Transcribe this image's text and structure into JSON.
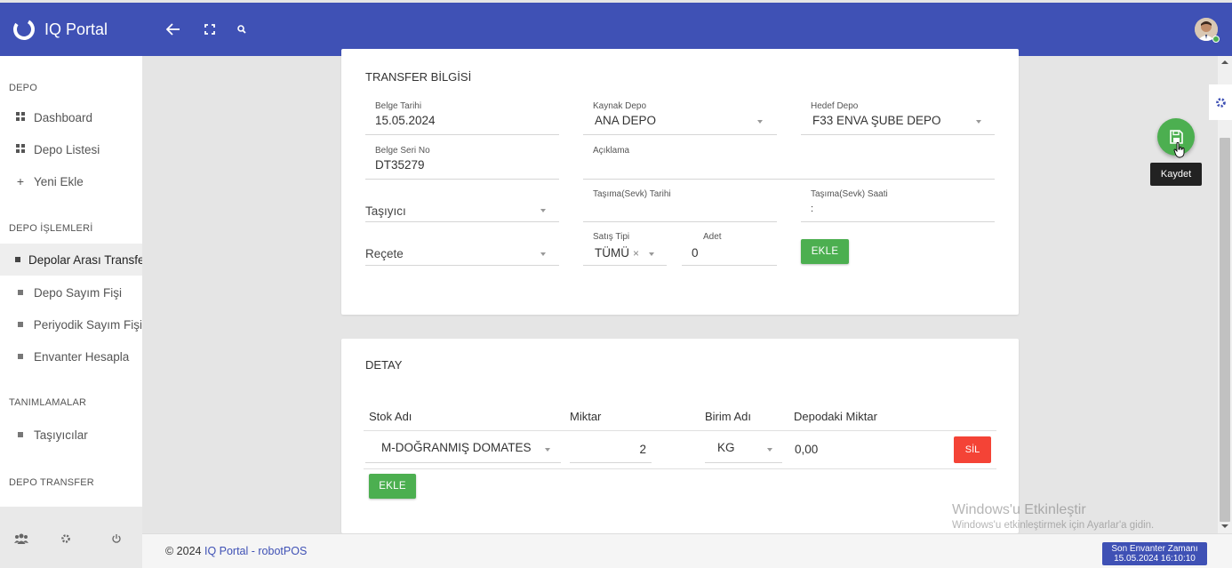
{
  "app": {
    "name": "IQ Portal"
  },
  "topbar": {
    "icons": [
      "back-arrow-icon",
      "fullscreen-icon",
      "search-icon"
    ]
  },
  "sidebar": {
    "sections": [
      {
        "header": "DEPO",
        "items": [
          {
            "label": "Dashboard",
            "icon": "grid-icon"
          },
          {
            "label": "Depo Listesi",
            "icon": "grid-icon"
          },
          {
            "label": "Yeni Ekle",
            "icon": "plus-icon"
          }
        ]
      },
      {
        "header": "DEPO İŞLEMLERİ",
        "items": [
          {
            "label": "Depolar Arası Transfer",
            "icon": "square-icon"
          },
          {
            "label": "Depo Sayım Fişi",
            "icon": "square-icon"
          },
          {
            "label": "Periyodik Sayım Fişi",
            "icon": "square-icon"
          },
          {
            "label": "Envanter Hesapla",
            "icon": "square-icon"
          }
        ]
      },
      {
        "header": "TANIMLAMALAR",
        "items": [
          {
            "label": "Taşıyıcılar",
            "icon": "square-icon"
          }
        ]
      },
      {
        "header": "DEPO TRANSFER",
        "items": []
      }
    ],
    "footer_icons": [
      "users-icon",
      "gear-icon",
      "power-icon"
    ]
  },
  "transfer": {
    "title": "TRANSFER BİLGİSİ",
    "belge_tarihi": {
      "label": "Belge Tarihi",
      "value": "15.05.2024"
    },
    "kaynak_depo": {
      "label": "Kaynak Depo",
      "value": "ANA DEPO"
    },
    "hedef_depo": {
      "label": "Hedef Depo",
      "value": "F33 ENVA ŞUBE DEPO"
    },
    "belge_seri_no": {
      "label": "Belge Seri No",
      "value": "DT35279"
    },
    "aciklama": {
      "label": "Açıklama",
      "value": ""
    },
    "tasiyici": {
      "placeholder": "Taşıyıcı"
    },
    "tasima_tarihi": {
      "label": "Taşıma(Sevk) Tarihi",
      "value": ""
    },
    "tasima_saati": {
      "label": "Taşıma(Sevk) Saati",
      "value": ":"
    },
    "recete": {
      "placeholder": "Reçete"
    },
    "satis_tipi": {
      "label": "Satış Tipi",
      "value": "TÜMÜ",
      "clear": "×"
    },
    "adet": {
      "label": "Adet",
      "value": "0"
    },
    "ekle_label": "EKLE"
  },
  "detay": {
    "title": "DETAY",
    "columns": [
      "Stok Adı",
      "Miktar",
      "Birim Adı",
      "Depodaki Miktar"
    ],
    "rows": [
      {
        "stok_adi": "M-DOĞRANMIŞ DOMATES",
        "miktar": "2",
        "birim_adi": "KG",
        "depodaki_miktar": "0,00",
        "delete_label": "SİL"
      }
    ],
    "ekle_label": "EKLE"
  },
  "actions": {
    "save_tooltip": "Kaydet"
  },
  "footer": {
    "copyright": "© 2024 ",
    "link": "IQ Portal - robotPOS"
  },
  "inventory_badge": {
    "line1": "Son Envanter Zamanı",
    "line2": "15.05.2024 16:10:10"
  },
  "watermark": {
    "line1": "Windows'u Etkinleştir",
    "line2": "Windows'u etkinleştirmek için Ayarlar'a gidin."
  },
  "colors": {
    "primary": "#3f51b5",
    "success": "#4caf50",
    "danger": "#f44336"
  }
}
